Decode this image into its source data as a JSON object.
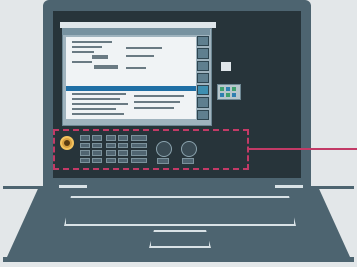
{
  "illustration": {
    "subject": "laptop",
    "icon": "laptop-icon"
  },
  "colors": {
    "background": "#e3e7e9",
    "laptop_body": "#4d6470",
    "screen": "#27343a",
    "highlight": "#c23a66",
    "knob": "#d7a040",
    "scroll_bar": "#1f6fa5"
  }
}
